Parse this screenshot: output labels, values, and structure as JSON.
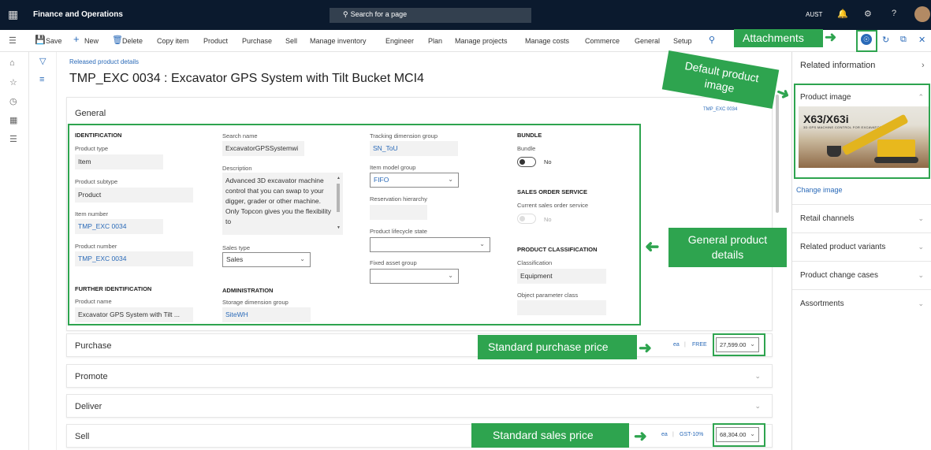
{
  "topbar": {
    "app_name": "Finance and Operations",
    "search_placeholder": "Search for a page",
    "company": "AUST",
    "help": "?"
  },
  "actionbar": {
    "save": "Save",
    "new": "New",
    "delete": "Delete",
    "copy_item": "Copy item",
    "menus": [
      "Product",
      "Purchase",
      "Sell",
      "Manage inventory",
      "Engineer",
      "Plan",
      "Manage projects",
      "Manage costs",
      "Commerce",
      "General",
      "Setup"
    ]
  },
  "page": {
    "breadcrumb": "Released product details",
    "title": "TMP_EXC 0034 : Excavator GPS System with Tilt Bucket MCI4"
  },
  "general": {
    "title": "General",
    "summary_right": "TMP_EXC 0034",
    "identification": {
      "heading": "IDENTIFICATION",
      "product_type_label": "Product type",
      "product_type": "Item",
      "product_subtype_label": "Product subtype",
      "product_subtype": "Product",
      "item_number_label": "Item number",
      "item_number": "TMP_EXC 0034",
      "product_number_label": "Product number",
      "product_number": "TMP_EXC 0034"
    },
    "further": {
      "heading": "FURTHER IDENTIFICATION",
      "product_name_label": "Product name",
      "product_name": "Excavator GPS System with Tilt ..."
    },
    "search_name_label": "Search name",
    "search_name": "ExcavatorGPSSystemwi",
    "description_label": "Description",
    "description": "Advanced 3D excavator machine control that you can swap to your digger, grader or other machine. Only Topcon gives you the flexibility to",
    "sales_type_label": "Sales type",
    "sales_type": "Sales",
    "administration": {
      "heading": "ADMINISTRATION",
      "storage_dim_label": "Storage dimension group",
      "storage_dim": "SiteWH"
    },
    "tracking_dim_label": "Tracking dimension group",
    "tracking_dim": "SN_ToU",
    "item_model_group_label": "Item model group",
    "item_model_group": "FIFO",
    "reservation_hierarchy_label": "Reservation hierarchy",
    "lifecycle_label": "Product lifecycle state",
    "fixed_asset_label": "Fixed asset group",
    "bundle": {
      "heading": "BUNDLE",
      "label": "Bundle",
      "value": "No"
    },
    "sales_order_service": {
      "heading": "SALES ORDER SERVICE",
      "label": "Current sales order service",
      "value": "No"
    },
    "classification": {
      "heading": "PRODUCT CLASSIFICATION",
      "label": "Classification",
      "value": "Equipment",
      "object_param_label": "Object parameter class"
    }
  },
  "purchase": {
    "title": "Purchase",
    "unit": "ea",
    "tax": "FREE",
    "price": "27,599.00"
  },
  "promote": {
    "title": "Promote"
  },
  "deliver": {
    "title": "Deliver"
  },
  "sell": {
    "title": "Sell",
    "unit": "ea",
    "tax": "GST-10%",
    "price": "68,304.00"
  },
  "right_panel": {
    "related_information": "Related information",
    "product_image": "Product image",
    "image_logo": "X63/X63i",
    "image_tagline": "3D GPS MACHINE CONTROL FOR EXCAVATORS",
    "change_image": "Change image",
    "sections": [
      "Retail channels",
      "Related product variants",
      "Product change cases",
      "Assortments"
    ]
  },
  "callouts": {
    "attachments": "Attachments",
    "default_image": "Default product image",
    "general_details": "General product details",
    "purchase_price": "Standard purchase price",
    "sales_price": "Standard sales price"
  },
  "colors": {
    "topbar": "#0b1a2e",
    "accent_green": "#2ea44f",
    "link_blue": "#2a6ab8"
  }
}
